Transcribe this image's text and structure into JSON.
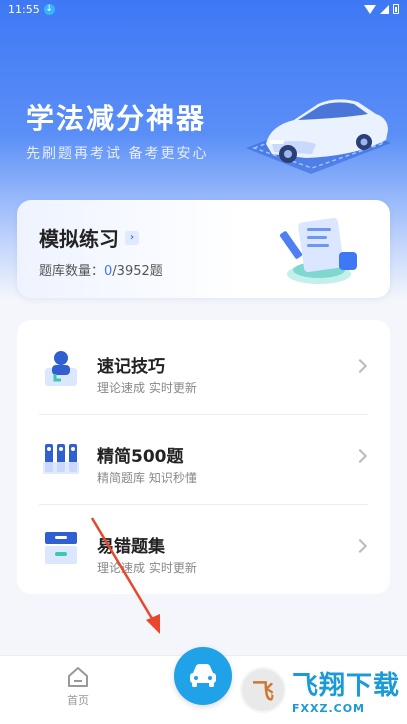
{
  "status_bar": {
    "time": "11:55",
    "download_badge": "↓"
  },
  "header": {
    "title": "学法减分神器",
    "subtitle": "先刷题再考试 备考更安心"
  },
  "practice_card": {
    "title": "模拟练习",
    "count_label": "题库数量：",
    "done": "0",
    "total": "/3952题"
  },
  "items": [
    {
      "name": "速记技巧",
      "desc": "理论速成 实时更新",
      "icon": "person-monitor-icon"
    },
    {
      "name": "精简500题",
      "desc": "精简题库 知识秒懂",
      "icon": "test-tubes-icon"
    },
    {
      "name": "易错题集",
      "desc": "理论速成 实时更新",
      "icon": "file-box-icon"
    }
  ],
  "bottom_nav": {
    "home_label": "首页"
  },
  "watermark": {
    "logo_letter": "飞",
    "text": "飞翔下载",
    "url": "FXXZ.COM"
  },
  "colors": {
    "primary": "#3e78f5",
    "accent": "#1fa2e8",
    "annotation_arrow": "#e8472e"
  }
}
